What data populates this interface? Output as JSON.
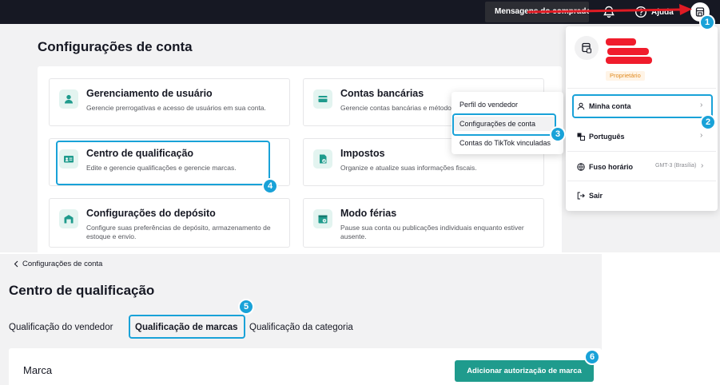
{
  "topbar": {
    "buyer_messages": "Mensagens do comprador",
    "help": "Ajuda",
    "icons": [
      "bell-icon",
      "help-icon",
      "store-avatar-icon"
    ]
  },
  "settings": {
    "title": "Configurações de conta",
    "cards": [
      {
        "title": "Gerenciamento de usuário",
        "desc": "Gerencie prerrogativas e acesso de usuários em sua conta.",
        "icon": "user-icon"
      },
      {
        "title": "Contas bancárias",
        "desc": "Gerencie contas bancárias e métodos",
        "icon": "bank-card-icon"
      },
      {
        "title": "Centro de qualificação",
        "desc": "Edite e gerencie qualificações e gerencie marcas.",
        "icon": "id-card-icon"
      },
      {
        "title": "Impostos",
        "desc": "Organize e atualize suas informações fiscais.",
        "icon": "tax-document-icon"
      },
      {
        "title": "Configurações do depósito",
        "desc": "Configure suas preferências de depósito, armazenamento de estoque e envio.",
        "icon": "warehouse-icon"
      },
      {
        "title": "Modo férias",
        "desc": "Pause sua conta ou publicações individuais enquanto estiver ausente.",
        "icon": "vacation-calendar-icon"
      }
    ]
  },
  "context_menu": {
    "items": [
      "Perfil do vendedor",
      "Configurações de conta",
      "Contas do TikTok vinculadas"
    ],
    "selected": "Configurações de conta"
  },
  "account_panel": {
    "role": "Proprietário",
    "items": [
      {
        "label": "Minha conta",
        "icon": "person-icon",
        "has_chevron": true
      },
      {
        "label": "Português",
        "icon": "translate-icon",
        "has_chevron": true
      },
      {
        "label": "Fuso horário",
        "icon": "globe-icon",
        "value": "GMT-3 (Brasília)",
        "has_chevron": true
      },
      {
        "label": "Sair",
        "icon": "logout-icon",
        "has_chevron": false
      }
    ]
  },
  "qualification_page": {
    "breadcrumb": "Configurações de conta",
    "title": "Centro de qualificação",
    "tabs": [
      "Qualificação do vendedor",
      "Qualificação de marcas",
      "Qualificação da categoria"
    ],
    "active_tab": "Qualificação de marcas",
    "section_title": "Marca",
    "add_button": "Adicionar autorização de marca"
  },
  "annotations": {
    "badges": [
      "1",
      "2",
      "3",
      "4",
      "5",
      "6"
    ],
    "highlight_color": "#19a2d8",
    "arrow_color": "#e01b24"
  },
  "colors": {
    "topbar_bg": "#161823",
    "accent_teal": "#1f9b8d",
    "icon_bg": "#e3f4f0",
    "owner_badge": "#e08a1e"
  }
}
